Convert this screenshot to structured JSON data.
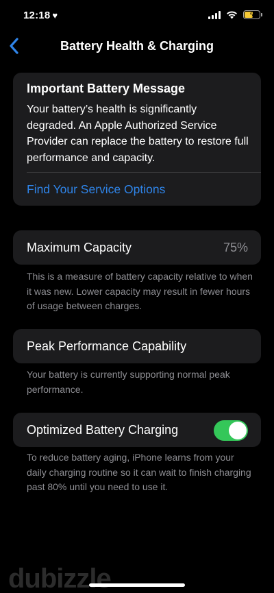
{
  "status_bar": {
    "time": "12:18",
    "heart": "♥",
    "battery_bolt": "ϟ",
    "battery_level": 0.6,
    "battery_color": "#f5c935"
  },
  "nav": {
    "back_icon": "chevron-left-icon",
    "title": "Battery Health & Charging"
  },
  "battery_message": {
    "title": "Important Battery Message",
    "body": "Your battery’s health is significantly degraded. An Apple Authorized Service Provider can replace the battery to restore full performance and capacity.",
    "link_label": "Find Your Service Options",
    "link_color": "#2f84e8"
  },
  "maximum_capacity": {
    "label": "Maximum Capacity",
    "value": "75%",
    "footnote": "This is a measure of battery capacity relative to when it was new. Lower capacity may result in fewer hours of usage between charges."
  },
  "peak_performance": {
    "label": "Peak Performance Capability",
    "footnote": "Your battery is currently supporting normal peak performance."
  },
  "optimized_charging": {
    "label": "Optimized Battery Charging",
    "enabled": true,
    "toggle_color": "#34c759",
    "footnote": "To reduce battery aging, iPhone learns from your daily charging routine so it can wait to finish charging past 80% until you need to use it."
  },
  "watermark": {
    "text": "dubizzle"
  }
}
